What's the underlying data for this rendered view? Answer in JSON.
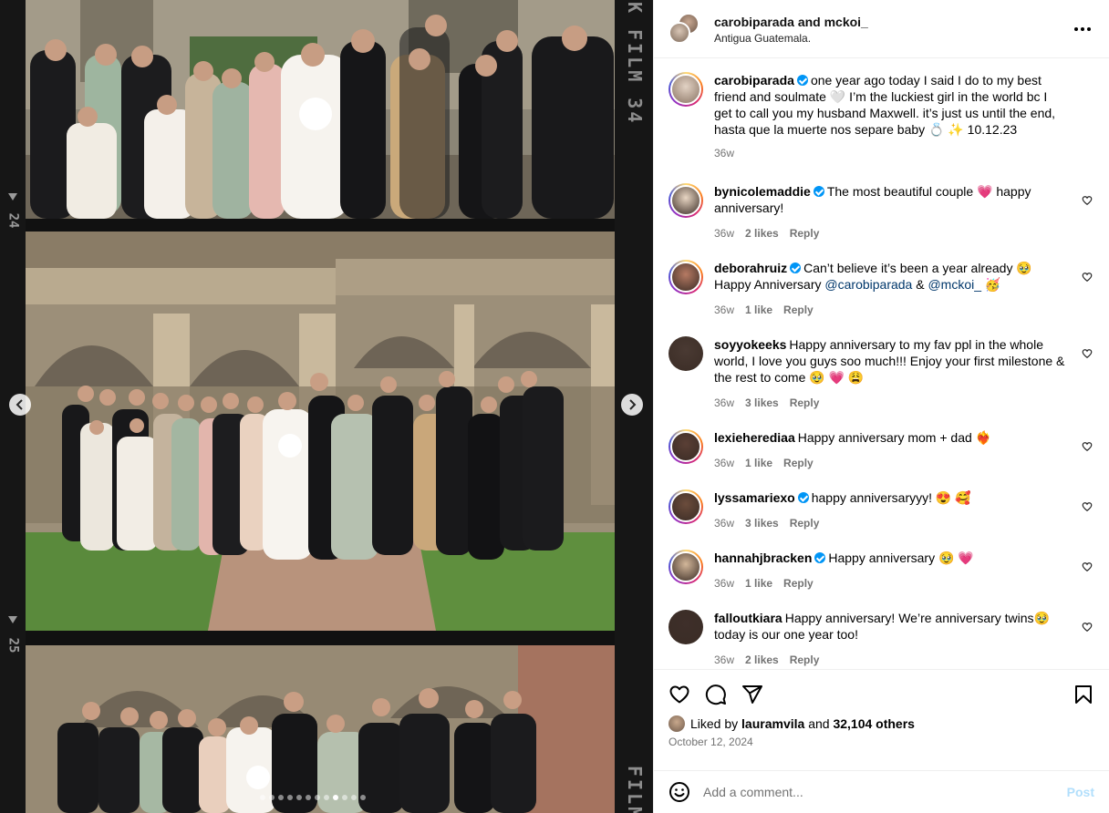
{
  "post": {
    "authors": "carobiparada and mckoi_",
    "location": "Antigua Guatemala."
  },
  "media": {
    "film_labels": {
      "frame_top": "24",
      "frame_bottom": "25",
      "brand_top": "K FILM 34",
      "brand_bottom": "FILM"
    },
    "carousel_dots": 12,
    "active_dot": 8
  },
  "caption": {
    "username": "carobiparada",
    "verified": true,
    "text": "one year ago today I said I do to my best friend and soulmate 🤍 I’m the luckiest girl in the world bc I get to call you my husband Maxwell. it’s just us until the end, hasta que la muerte nos separe baby 💍 ✨ 10.12.23",
    "time": "36w"
  },
  "comments": [
    {
      "username": "bynicolemaddie",
      "verified": true,
      "text": "The most beautiful couple 💗 happy anniversary!",
      "time": "36w",
      "likes": "2 likes",
      "reply": "Reply",
      "ring": true,
      "avatar_color": "#e8d6c3"
    },
    {
      "username": "deborahruiz",
      "verified": true,
      "text_before": "Can’t believe it’s been a year already 🥹 Happy Anniversary",
      "mention1": "@carobiparada",
      "amp": "&",
      "mention2": "@mckoi_",
      "text_after": "🥳",
      "time": "36w",
      "likes": "1 like",
      "reply": "Reply",
      "ring": true,
      "avatar_color": "#b67a63"
    },
    {
      "username": "soyyokeeks",
      "verified": false,
      "text": "Happy anniversary to my fav ppl in the whole world, I love you guys soo much!!! Enjoy your first milestone & the rest to come 🥹 💗 😩",
      "time": "36w",
      "likes": "3 likes",
      "reply": "Reply",
      "ring": false,
      "avatar_color": "#4a3a33"
    },
    {
      "username": "lexieherediaa",
      "verified": false,
      "text": "Happy anniversary mom + dad ❤️‍🔥",
      "time": "36w",
      "likes": "1 like",
      "reply": "Reply",
      "ring": true,
      "avatar_color": "#5a3f35"
    },
    {
      "username": "lyssamariexo",
      "verified": true,
      "text": "happy anniversaryyy! 😍 🥰",
      "time": "36w",
      "likes": "3 likes",
      "reply": "Reply",
      "ring": true,
      "avatar_color": "#6b4c3c"
    },
    {
      "username": "hannahjbracken",
      "verified": true,
      "text": "Happy anniversary 🥹 💗",
      "time": "36w",
      "likes": "1 like",
      "reply": "Reply",
      "ring": true,
      "avatar_color": "#d3b79a"
    },
    {
      "username": "falloutkiara",
      "verified": false,
      "text": "Happy anniversary! We’re anniversary twins🥹 today is our one year too!",
      "time": "36w",
      "likes": "2 likes",
      "reply": "Reply",
      "ring": false,
      "avatar_color": "#3e2f2a"
    }
  ],
  "likes": {
    "prefix": "Liked by",
    "user": "lauramvila",
    "and": "and",
    "others": "32,104 others"
  },
  "date": "October 12, 2024",
  "composer": {
    "placeholder": "Add a comment...",
    "post_label": "Post"
  },
  "icons": [
    "heart-icon",
    "comment-icon",
    "share-icon",
    "bookmark-icon",
    "emoji-icon",
    "more-icon",
    "chevron-left-icon",
    "chevron-right-icon",
    "verified-badge-icon"
  ],
  "colors": {
    "accent": "#0095f6",
    "muted": "#737373",
    "post_disabled": "#b2dffc",
    "mention": "#00376b"
  }
}
